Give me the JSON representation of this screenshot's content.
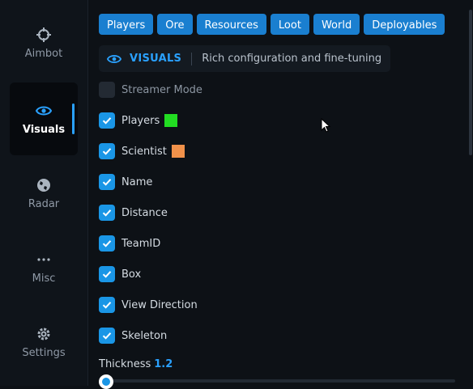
{
  "sidebar": {
    "items": [
      {
        "label": "Aimbot",
        "icon": "crosshair-icon"
      },
      {
        "label": "Visuals",
        "icon": "eye-icon",
        "active": true
      },
      {
        "label": "Radar",
        "icon": "globe-icon"
      },
      {
        "label": "Misc",
        "icon": "ellipsis-icon"
      },
      {
        "label": "Settings",
        "icon": "gear-icon"
      }
    ]
  },
  "tabs": [
    "Players",
    "Ore",
    "Resources",
    "Loot",
    "World",
    "Deployables"
  ],
  "header": {
    "title": "VISUALS",
    "subtitle": "Rich configuration and fine-tuning"
  },
  "options": [
    {
      "label": "Streamer Mode",
      "checked": false
    },
    {
      "label": "Players",
      "checked": true,
      "color": "#22dd22"
    },
    {
      "label": "Scientist",
      "checked": true,
      "color": "#f0914a"
    },
    {
      "label": "Name",
      "checked": true
    },
    {
      "label": "Distance",
      "checked": true
    },
    {
      "label": "TeamID",
      "checked": true
    },
    {
      "label": "Box",
      "checked": true
    },
    {
      "label": "View Direction",
      "checked": true
    },
    {
      "label": "Skeleton",
      "checked": true
    }
  ],
  "thickness": {
    "label": "Thickness",
    "value": "1.2"
  },
  "colors": {
    "accent": "#1a96e6",
    "background": "#0d1116"
  }
}
